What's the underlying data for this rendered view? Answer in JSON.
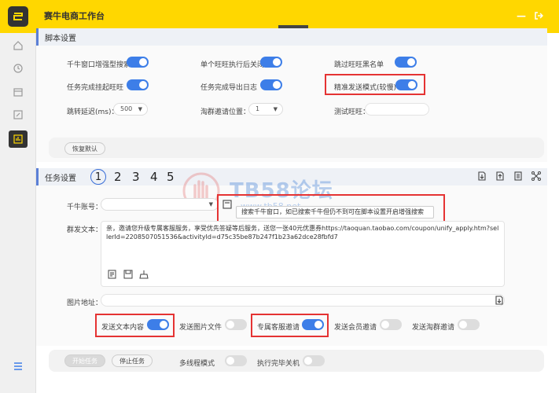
{
  "app": {
    "title": "赛牛电商工作台",
    "minimize": "—",
    "exit_icon": "exit-icon"
  },
  "sidebar": {
    "icons": [
      "home-icon",
      "clock-icon",
      "calendar-icon",
      "edit-icon",
      "report-icon",
      "menu-icon"
    ]
  },
  "script_settings": {
    "header": "脚本设置",
    "toggles": [
      {
        "label": "千牛窗口增强型搜索",
        "on": true
      },
      {
        "label": "单个旺旺执行后关闭",
        "on": true
      },
      {
        "label": "跳过旺旺黑名单",
        "on": true
      },
      {
        "label": "任务完成挂起旺旺",
        "on": true
      },
      {
        "label": "任务完成导出日志",
        "on": true
      },
      {
        "label": "精准发送模式(较慢)",
        "on": true
      }
    ],
    "jump_delay_label": "跳转延迟(ms)：",
    "jump_delay_value": "500",
    "taoqun_label": "淘群邀请位置：",
    "taoqun_value": "1",
    "test_ww_label": "测试旺旺：",
    "reset_button": "恢复默认"
  },
  "task_settings": {
    "header": "任务设置",
    "tabs": [
      "1",
      "2",
      "3",
      "4",
      "5"
    ],
    "active_tab": "1",
    "qianniu_label": "千牛账号：",
    "tooltip": "搜索千牛窗口，如已搜索千牛但仍不到可在脚本设置开启增强搜索",
    "group_text_label": "群发文本：",
    "group_text": "亲，邀请您升级专属客服服务，享受优先答疑等后服务，送您一张40元优惠券https://taoquan.taobao.com/coupon/unify_apply.htm?sellerId=2208507051536&activityId=d75c35be87b247f1b23a62dce28fbfd7",
    "image_label": "图片地址：",
    "send_toggles": [
      {
        "label": "发送文本内容",
        "on": true
      },
      {
        "label": "发送图片文件",
        "on": false
      },
      {
        "label": "专属客服邀请",
        "on": true
      },
      {
        "label": "发送会员邀请",
        "on": false
      },
      {
        "label": "发送淘群邀请",
        "on": false
      }
    ]
  },
  "footer": {
    "start_button": "开始任务",
    "stop_button": "停止任务",
    "multi_process_label": "多线程模式",
    "multi_process_on": false,
    "shutdown_label": "执行完毕关机",
    "shutdown_on": false
  },
  "watermark": {
    "text": "TB58论坛",
    "sub": "www.tb58.net"
  },
  "colors": {
    "accent": "#ffd700",
    "toggle_on": "#3d7ee8",
    "highlight": "#e53333"
  }
}
